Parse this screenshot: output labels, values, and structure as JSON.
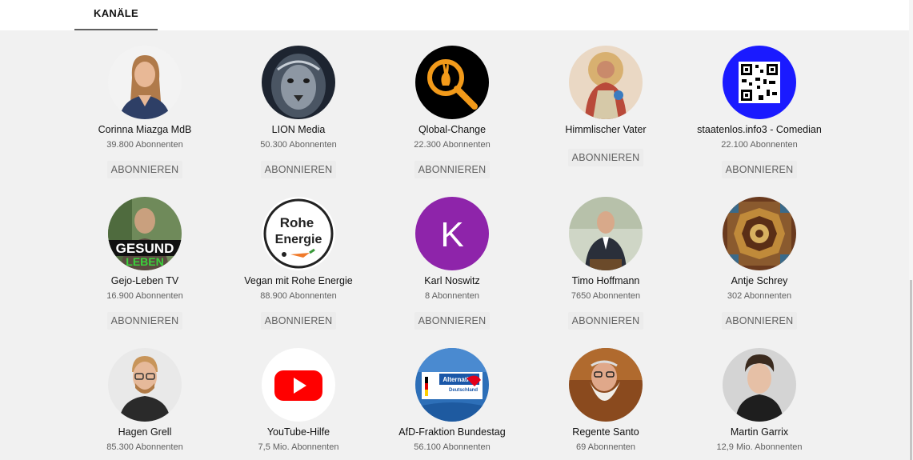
{
  "tabs": {
    "active_label": "KANÄLE"
  },
  "subscribe_label": "ABONNIEREN",
  "channels": [
    {
      "name": "Corinna Miazga MdB",
      "subscribers": "39.800 Abonnenten",
      "avatar": "woman-portrait-icon"
    },
    {
      "name": "LION Media",
      "subscribers": "50.300 Abonnenten",
      "avatar": "lion-icon"
    },
    {
      "name": "Qlobal-Change",
      "subscribers": "22.300 Abonnenten",
      "avatar": "rabbit-magnifier-icon"
    },
    {
      "name": "Himmlischer Vater",
      "subscribers": "",
      "avatar": "religious-figure-icon"
    },
    {
      "name": "staatenlos.info3 - Comedian",
      "subscribers": "22.100 Abonnenten",
      "avatar": "qr-code-icon"
    },
    {
      "name": "Gejo-Leben TV",
      "subscribers": "16.900 Abonnenten",
      "avatar": "gesund-leben-icon",
      "avatar_text": [
        "GESUND",
        "LEBEN"
      ]
    },
    {
      "name": "Vegan mit Rohe Energie",
      "subscribers": "88.900 Abonnenten",
      "avatar": "rohe-energie-logo-icon",
      "avatar_text": [
        "Rohe",
        "Energie"
      ]
    },
    {
      "name": "Karl Noswitz",
      "subscribers": "8 Abonnenten",
      "avatar": "letter-k-icon",
      "avatar_text": [
        "K"
      ]
    },
    {
      "name": "Timo Hoffmann",
      "subscribers": "7650 Abonnenten",
      "avatar": "speaker-portrait-icon"
    },
    {
      "name": "Antje Schrey",
      "subscribers": "302 Abonnenten",
      "avatar": "ornate-ceiling-icon"
    },
    {
      "name": "Hagen Grell",
      "subscribers": "85.300 Abonnenten",
      "avatar": "man-portrait-icon"
    },
    {
      "name": "YouTube-Hilfe",
      "subscribers": "7,5 Mio. Abonnenten",
      "avatar": "youtube-logo-icon"
    },
    {
      "name": "AfD-Fraktion Bundestag",
      "subscribers": "56.100 Abonnenten",
      "avatar": "afd-logo-icon",
      "avatar_text": [
        "Alternative",
        "Deutschland"
      ]
    },
    {
      "name": "Regente Santo",
      "subscribers": "69 Abonnenten",
      "avatar": "bearded-man-icon"
    },
    {
      "name": "Martin Garrix",
      "subscribers": "12,9 Mio. Abonnenten",
      "avatar": "young-man-portrait-icon"
    }
  ],
  "colors": {
    "background": "#f1f1f1",
    "button_bg": "#ececec",
    "button_text": "#606060",
    "youtube_red": "#ff0000",
    "karl_purple": "#8e24aa",
    "staatenlos_blue": "#1a1aff"
  }
}
